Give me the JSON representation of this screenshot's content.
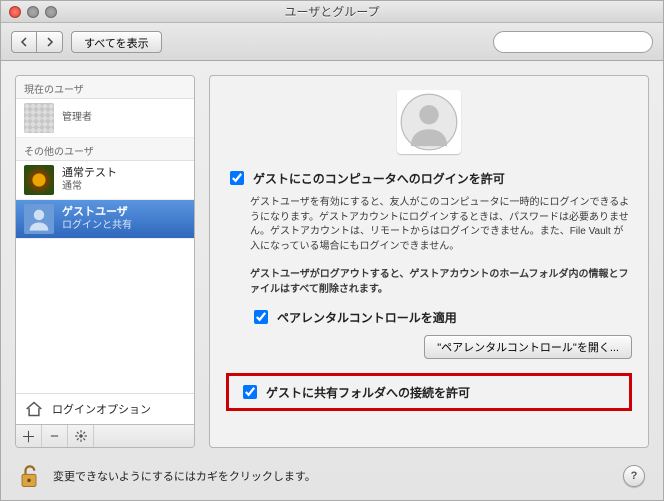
{
  "window": {
    "title": "ユーザとグループ"
  },
  "toolbar": {
    "show_all": "すべてを表示",
    "search_placeholder": ""
  },
  "sidebar": {
    "group_current": "現在のユーザ",
    "group_other": "その他のユーザ",
    "current": {
      "name": " ",
      "role": "管理者"
    },
    "others": [
      {
        "name": "通常テスト",
        "role": "通常"
      },
      {
        "name": "ゲストユーザ",
        "role": "ログインと共有"
      }
    ],
    "login_options": "ログインオプション"
  },
  "main": {
    "allow_login_label": "ゲストにこのコンピュータへのログインを許可",
    "desc1": "ゲストユーザを有効にすると、友人がこのコンピュータに一時的にログインできるようになります。ゲストアカウントにログインするときは、パスワードは必要ありません。ゲストアカウントは、リモートからはログインできません。また、File Vault が入になっている場合にもログインできません。",
    "desc2": "ゲストユーザがログアウトすると、ゲストアカウントのホームフォルダ内の情報とファイルはすべて削除されます。",
    "parental_label": "ペアレンタルコントロールを適用",
    "parental_button": "\"ペアレンタルコントロール\"を開く...",
    "allow_share_label": "ゲストに共有フォルダへの接続を許可"
  },
  "lock": {
    "text": "変更できないようにするにはカギをクリックします。",
    "help": "?"
  }
}
